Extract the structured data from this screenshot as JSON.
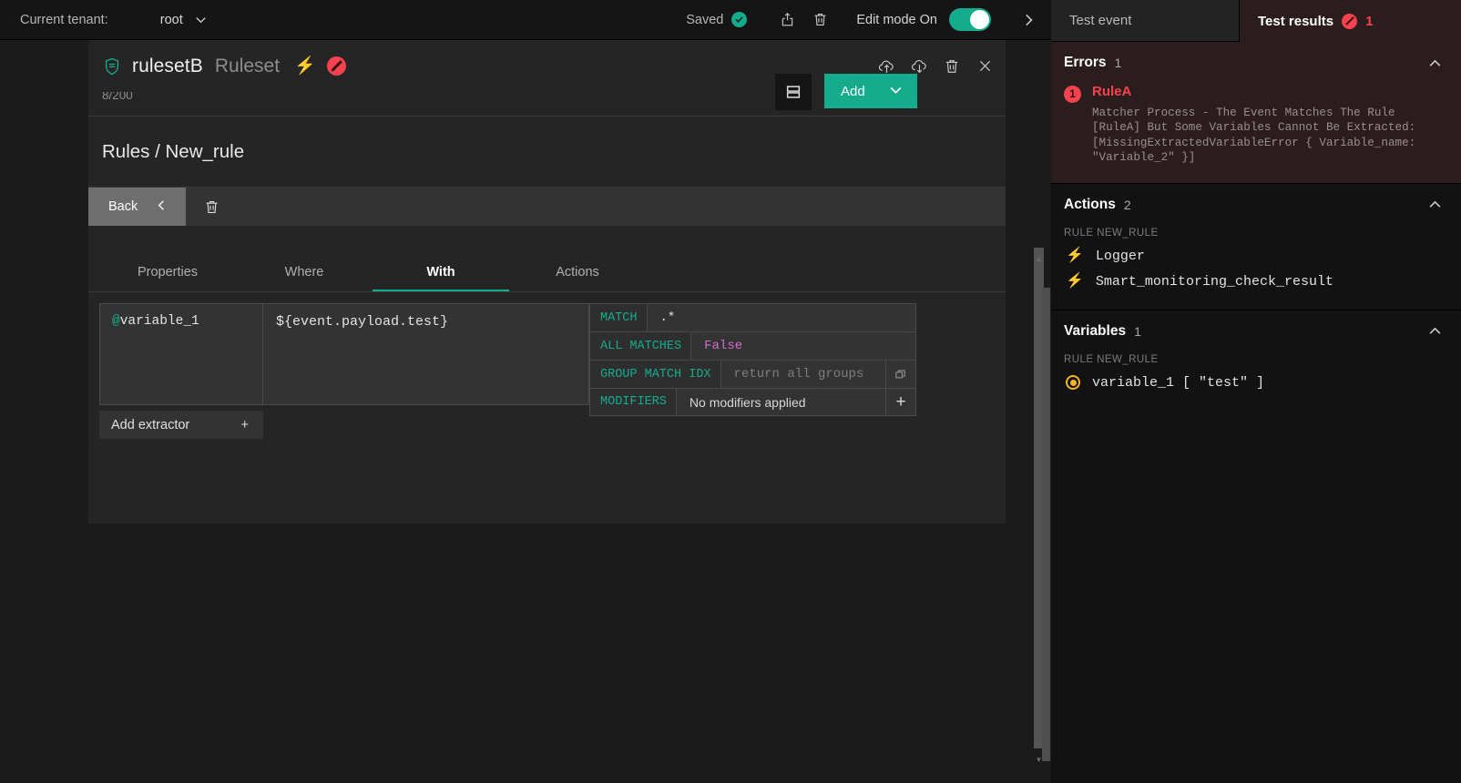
{
  "topbar": {
    "tenant_label": "Current tenant:",
    "tenant_value": "root",
    "saved_label": "Saved",
    "edit_mode_label": "Edit mode On",
    "icons": {
      "caret": "chevron-down-icon",
      "check": "check-icon",
      "export": "export-icon",
      "delete": "trash-icon",
      "expand": "chevron-right-icon"
    }
  },
  "editor": {
    "ruleset_name": "rulesetB",
    "ruleset_type": "Ruleset",
    "bolt": "⚡",
    "counter": "8/200",
    "breadcrumb": "Rules / New_rule",
    "back_label": "Back",
    "add_label": "Add",
    "tabs": [
      {
        "label": "Properties",
        "active": false
      },
      {
        "label": "Where",
        "active": false
      },
      {
        "label": "With",
        "active": true
      },
      {
        "label": "Actions",
        "active": false
      }
    ],
    "extractor": {
      "variable_at": "@",
      "variable_name": "variable_1",
      "expression": "${event.payload.test}",
      "add_extractor_label": "Add extractor",
      "add_extractor_plus": "+",
      "properties": [
        {
          "label": "MATCH",
          "value": ".*",
          "kind": "code"
        },
        {
          "label": "ALL MATCHES",
          "value": "False",
          "kind": "bool"
        },
        {
          "label": "GROUP MATCH IDX",
          "value": "return all groups",
          "kind": "placeholder"
        },
        {
          "label": "MODIFIERS",
          "value": "No modifiers applied",
          "kind": "plain"
        }
      ],
      "modifiers_plus": "+"
    }
  },
  "right_panel": {
    "tabs": {
      "test_event": "Test event",
      "test_results": "Test results",
      "test_results_count": "1"
    },
    "errors": {
      "title": "Errors",
      "count": "1",
      "items": [
        {
          "index": "1",
          "rule": "RuleA",
          "message": "Matcher Process - The Event Matches The Rule [RuleA] But Some Variables Cannot Be Extracted: [MissingExtractedVariableError { Variable_name: \"Variable_2\" }]"
        }
      ]
    },
    "actions": {
      "title": "Actions",
      "count": "2",
      "rule_subheading": "RULE NEW_RULE",
      "items": [
        {
          "label": "Logger",
          "icon": "bolt-icon"
        },
        {
          "label": "Smart_monitoring_check_result",
          "icon": "bolt-icon"
        }
      ]
    },
    "variables": {
      "title": "Variables",
      "count": "1",
      "rule_subheading": "RULE NEW_RULE",
      "items": [
        {
          "label": "variable_1 [ \"test\" ]",
          "icon": "radio-dot-icon"
        }
      ]
    }
  },
  "colors": {
    "accent": "#15ac8e",
    "error": "#f4434f",
    "warning": "#f5b427",
    "magenta": "#d66bd6"
  }
}
